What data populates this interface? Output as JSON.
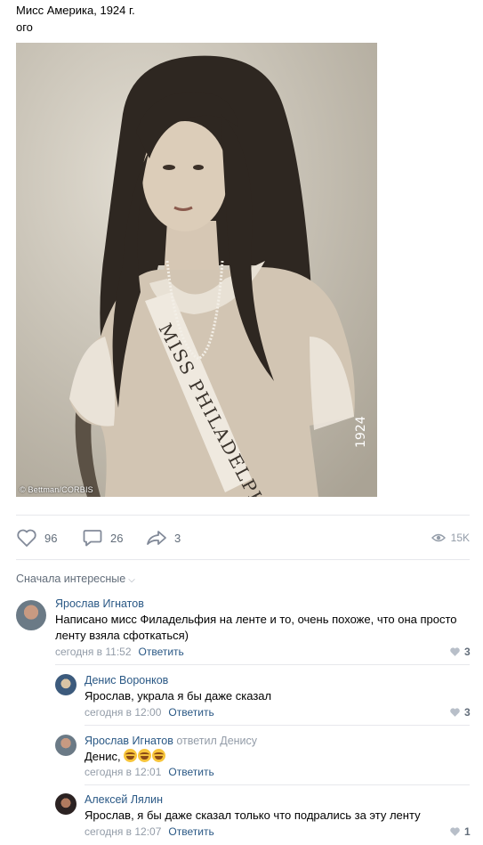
{
  "post": {
    "title": "Мисс Америка, 1924 г.",
    "subtitle": "ого",
    "photo_credit": "© Bettman/CORBIS",
    "sash_text": "MISS PHILADELPHIA",
    "corner_mark": "1924"
  },
  "actions": {
    "likes": "96",
    "comments": "26",
    "shares": "3",
    "views": "15K"
  },
  "comments_sort": {
    "label": "Сначала интересные"
  },
  "comments": [
    {
      "author": "Ярослав Игнатов",
      "text_line1": "Написано мисс Филадельфия на ленте и то, очень похоже, что она просто",
      "text_line2": "ленту взяла сфоткаться)",
      "time": "сегодня в 11:52",
      "reply_label": "Ответить",
      "likes": "3"
    },
    {
      "author": "Денис Воронков",
      "text": "Ярослав, украла я бы даже сказал",
      "time": "сегодня в 12:00",
      "reply_label": "Ответить",
      "likes": "3"
    },
    {
      "author": "Ярослав Игнатов",
      "replied_to": "ответил Денису",
      "text": "Денис,",
      "time": "сегодня в 12:01",
      "reply_label": "Ответить",
      "emoji_name": "tears-of-joy"
    },
    {
      "author": "Алексей Лялин",
      "text": "Ярослав, я бы даже сказал только что подрались за эту ленту",
      "time": "сегодня в 12:07",
      "reply_label": "Ответить",
      "likes": "1"
    }
  ],
  "colors": {
    "link": "#2a5885",
    "meta": "#939ca8",
    "action": "#626d7a",
    "divider": "#e7e8ec"
  }
}
